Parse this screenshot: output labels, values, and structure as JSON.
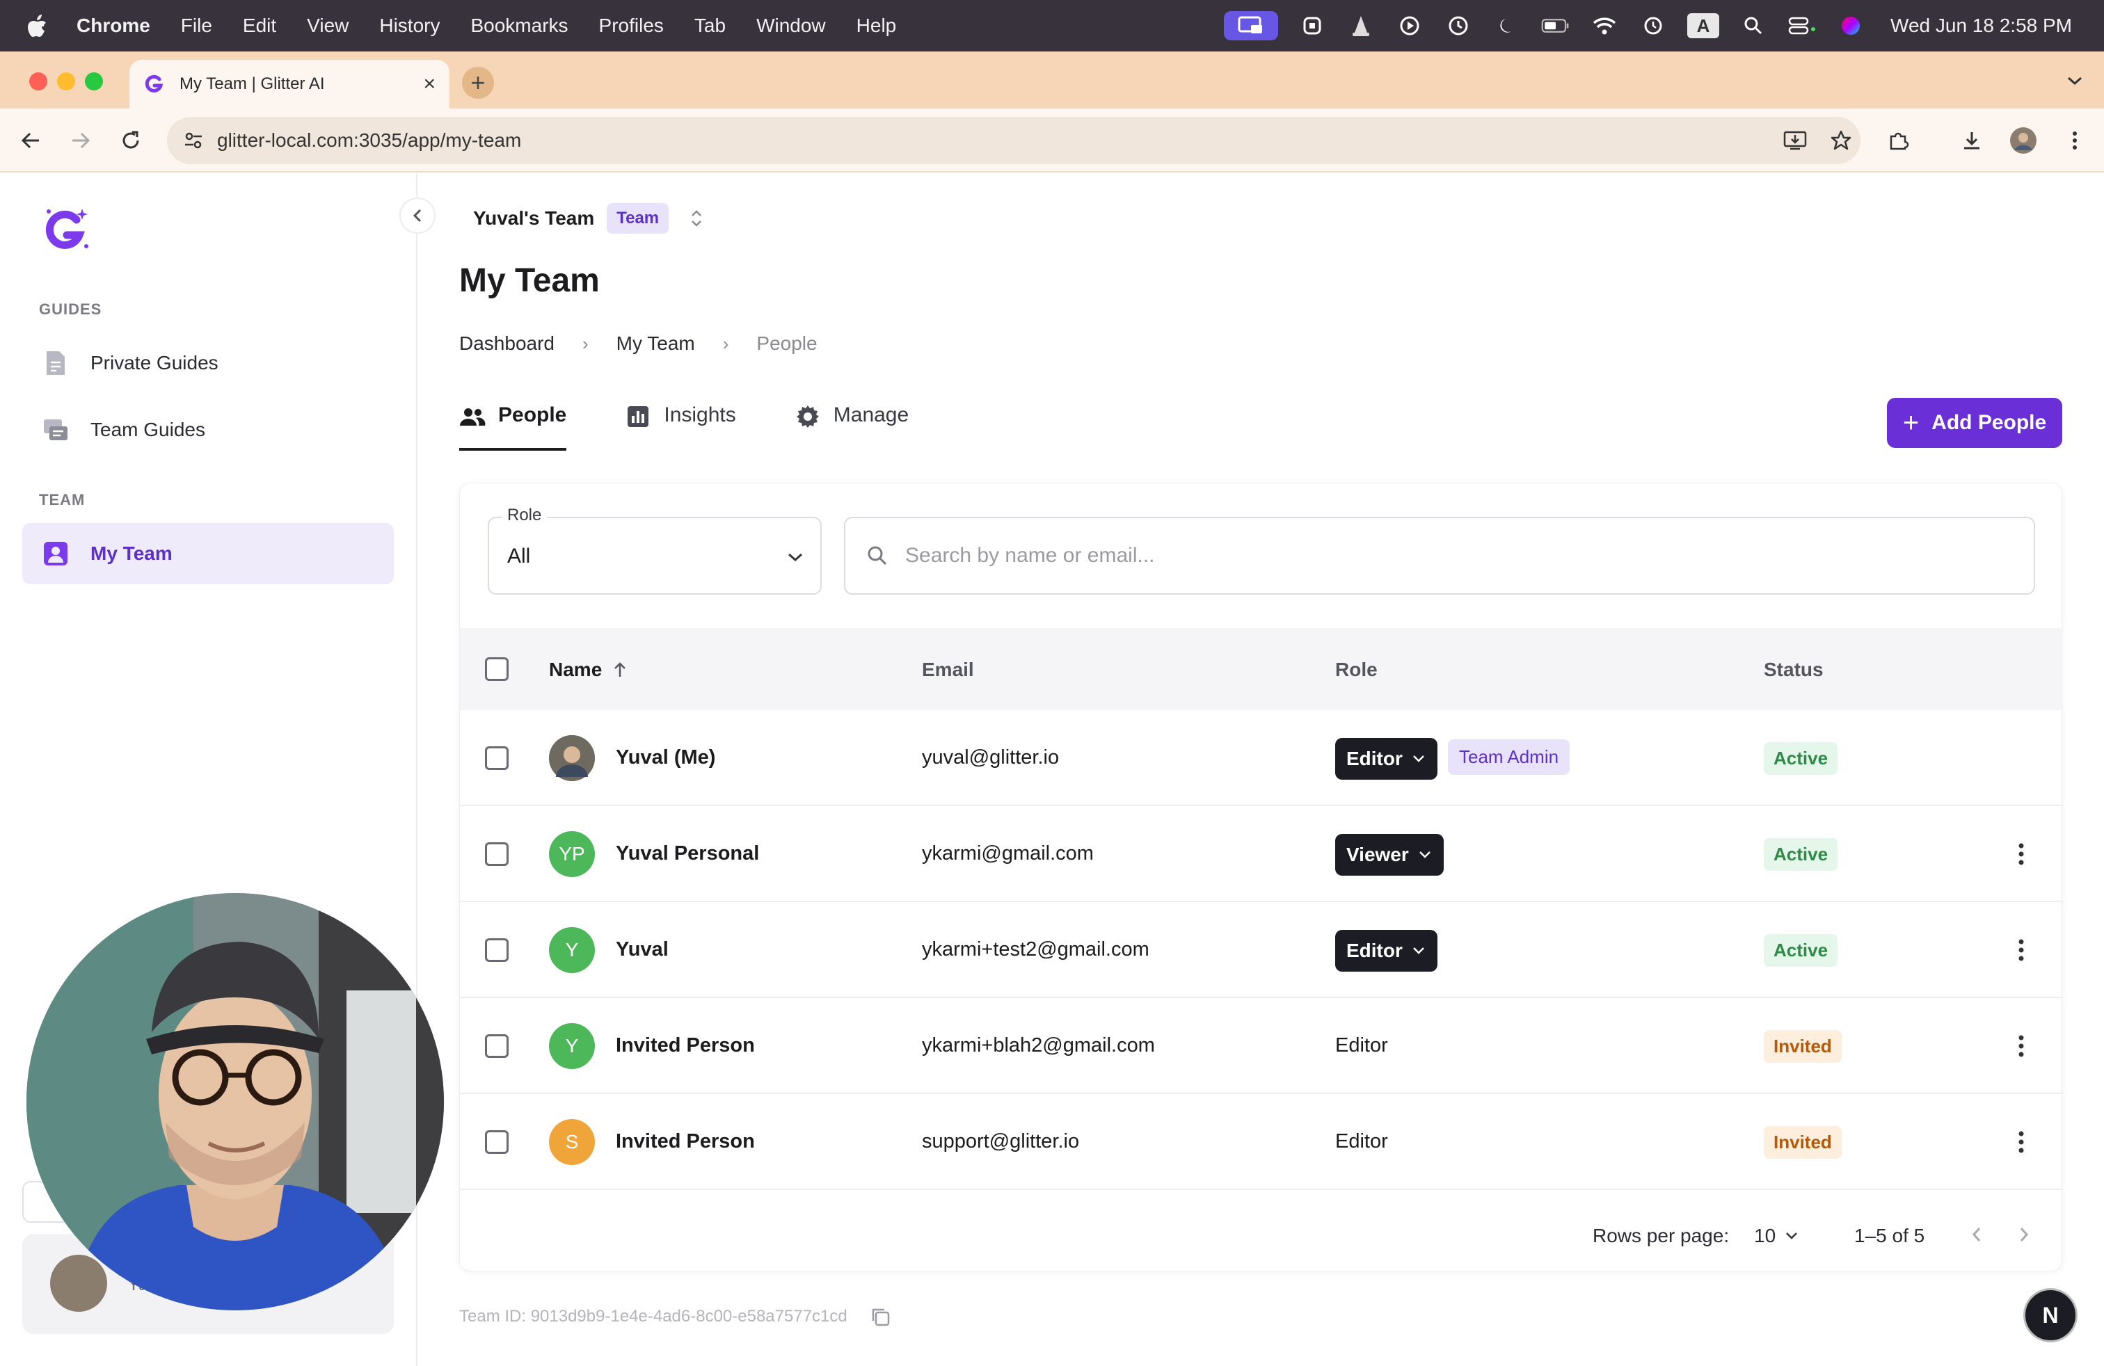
{
  "menubar": {
    "app_name": "Chrome",
    "items": [
      "File",
      "Edit",
      "View",
      "History",
      "Bookmarks",
      "Profiles",
      "Tab",
      "Window",
      "Help"
    ],
    "input_indicator": "A",
    "clock": "Wed Jun 18  2:58 PM"
  },
  "browser": {
    "tab_title": "My Team | Glitter AI",
    "url": "glitter-local.com:3035/app/my-team"
  },
  "sidebar": {
    "guides_label": "GUIDES",
    "guides_items": [
      {
        "label": "Private Guides",
        "icon": "document-icon"
      },
      {
        "label": "Team Guides",
        "icon": "team-guides-icon"
      }
    ],
    "team_label": "TEAM",
    "team_items": [
      {
        "label": "My Team",
        "icon": "user-square-icon",
        "selected": true
      }
    ],
    "user_name_partial": "Yuval"
  },
  "team_switcher": {
    "name": "Yuval's Team",
    "badge": "Team"
  },
  "page": {
    "title": "My Team",
    "breadcrumb": [
      "Dashboard",
      "My Team",
      "People"
    ],
    "tabs": [
      {
        "label": "People",
        "icon": "people-icon",
        "active": true
      },
      {
        "label": "Insights",
        "icon": "bar-chart-icon",
        "active": false
      },
      {
        "label": "Manage",
        "icon": "gear-icon",
        "active": false
      }
    ],
    "add_button": "Add People"
  },
  "filters": {
    "role_label": "Role",
    "role_value": "All",
    "search_placeholder": "Search by name or email..."
  },
  "table": {
    "columns": [
      "Name",
      "Email",
      "Role",
      "Status"
    ],
    "rows": [
      {
        "name": "Yuval (Me)",
        "avatar": "photo",
        "avatar_color": "#7d7064",
        "email": "yuval@glitter.io",
        "role": "Editor",
        "role_dropdown": true,
        "extra_badge": "Team Admin",
        "status": "Active",
        "status_kind": "active",
        "has_menu": false
      },
      {
        "name": "Yuval Personal",
        "avatar": "YP",
        "avatar_color": "#4cb85a",
        "email": "ykarmi@gmail.com",
        "role": "Viewer",
        "role_dropdown": true,
        "extra_badge": "",
        "status": "Active",
        "status_kind": "active",
        "has_menu": true
      },
      {
        "name": "Yuval",
        "avatar": "Y",
        "avatar_color": "#4cb85a",
        "email": "ykarmi+test2@gmail.com",
        "role": "Editor",
        "role_dropdown": true,
        "extra_badge": "",
        "status": "Active",
        "status_kind": "active",
        "has_menu": true
      },
      {
        "name": "Invited Person",
        "avatar": "Y",
        "avatar_color": "#4cb85a",
        "email": "ykarmi+blah2@gmail.com",
        "role": "Editor",
        "role_dropdown": false,
        "extra_badge": "",
        "status": "Invited",
        "status_kind": "invited",
        "has_menu": true
      },
      {
        "name": "Invited Person",
        "avatar": "S",
        "avatar_color": "#f0a53a",
        "email": "support@glitter.io",
        "role": "Editor",
        "role_dropdown": false,
        "extra_badge": "",
        "status": "Invited",
        "status_kind": "invited",
        "has_menu": true
      }
    ],
    "pagination": {
      "rows_per_page_label": "Rows per page:",
      "rows_per_page": "10",
      "range": "1–5 of 5"
    }
  },
  "footer": {
    "team_id": "Team ID: 9013d9b9-1e4e-4ad6-8c00-e58a7577c1cd"
  },
  "fab": {
    "label": "N"
  },
  "colors": {
    "accent": "#6a2fd6",
    "active_green": "#2f8a47",
    "invited_orange": "#b35a0b",
    "tab_strip": "#f6d6b6"
  }
}
